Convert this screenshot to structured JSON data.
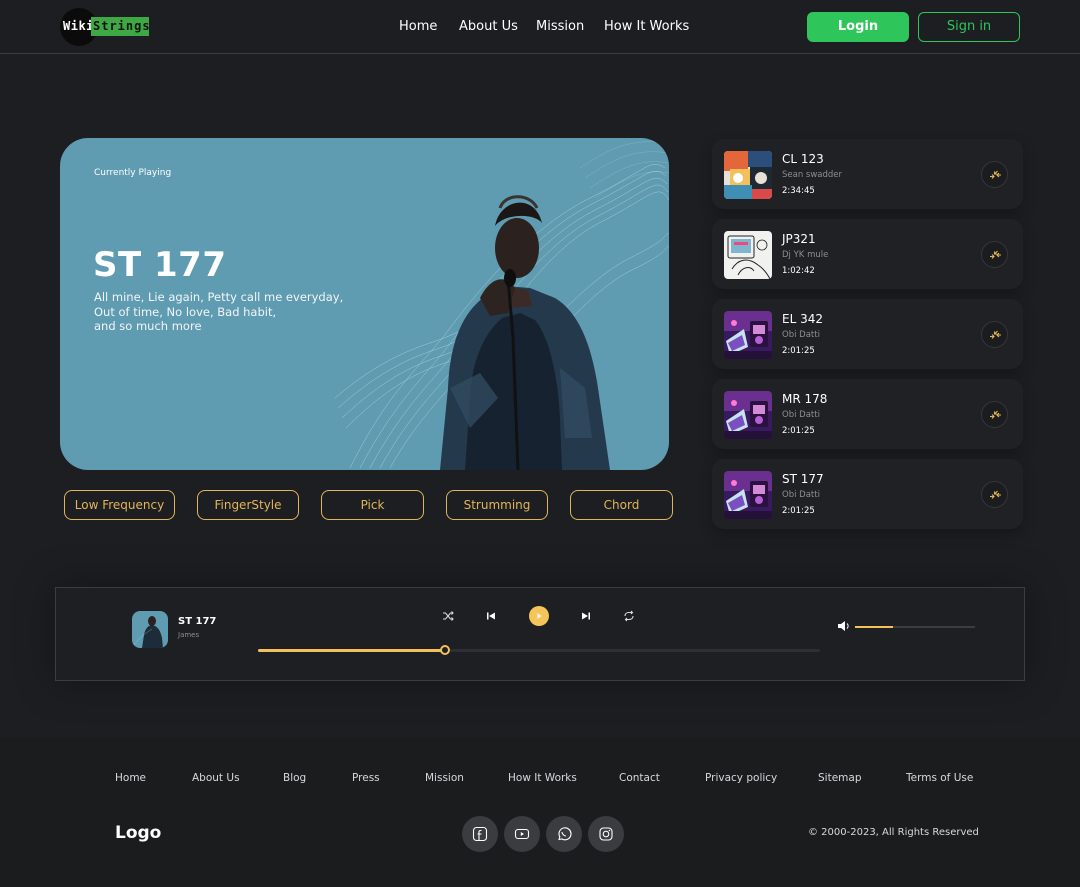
{
  "brand": {
    "logo_left": "Wiki",
    "logo_right": "Strings"
  },
  "nav": {
    "items": [
      "Home",
      "About Us",
      "Mission",
      "How It Works"
    ],
    "login": "Login",
    "signin": "Sign in"
  },
  "hero": {
    "label": "Currently Playing",
    "title": "ST 177",
    "desc_lines": [
      "All mine, Lie again, Petty call me everyday,",
      "Out of time, No love, Bad habit,",
      "and so much more"
    ]
  },
  "genres": [
    "Low Frequency",
    "FingerStyle",
    "Pick",
    "Strumming",
    "Chord"
  ],
  "playlist": [
    {
      "title": "CL 123",
      "artist": "Sean swadder",
      "duration": "2:34:45",
      "art": "collage"
    },
    {
      "title": "JP321",
      "artist": "Dj YK mule",
      "duration": "1:02:42",
      "art": "sketch"
    },
    {
      "title": "EL 342",
      "artist": "Obi Datti",
      "duration": "2:01:25",
      "art": "neon"
    },
    {
      "title": "MR 178",
      "artist": "Obi Datti",
      "duration": "2:01:25",
      "art": "neon"
    },
    {
      "title": "ST 177",
      "artist": "Obi Datti",
      "duration": "2:01:25",
      "art": "neon"
    }
  ],
  "player": {
    "title": "ST 177",
    "artist": "James",
    "progress_fraction": 0.333,
    "volume_fraction": 0.32,
    "controls": [
      "shuffle-icon",
      "previous-icon",
      "play-icon",
      "next-icon",
      "repeat-icon",
      "volume-icon"
    ]
  },
  "footer": {
    "links": [
      "Home",
      "About Us",
      "Blog",
      "Press",
      "Mission",
      "How It Works",
      "Contact",
      "Privacy policy",
      "Sitemap",
      "Terms of Use"
    ],
    "logo": "Logo",
    "social": [
      "facebook-icon",
      "youtube-icon",
      "whatsapp-icon",
      "instagram-icon"
    ],
    "copyright": "© 2000-2023, All Rights Reserved"
  },
  "colors": {
    "accent_green": "#2ec55a",
    "accent_gold": "#e3b45a",
    "hero_bg": "#5f9bb1",
    "page_bg": "#1c1e21"
  }
}
